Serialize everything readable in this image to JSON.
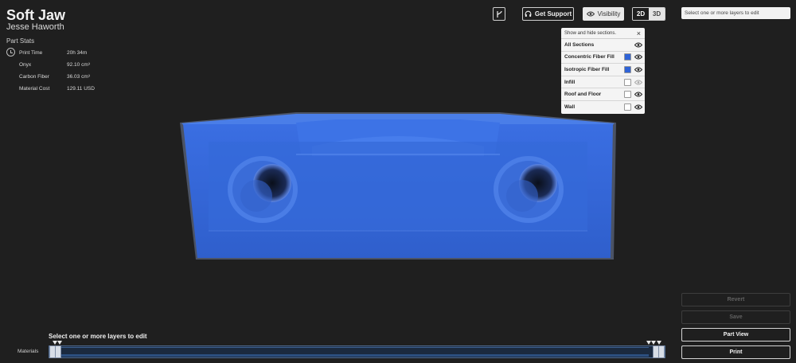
{
  "header": {
    "title": "Soft Jaw",
    "author": "Jesse Haworth"
  },
  "stats": {
    "heading": "Part Stats",
    "rows": [
      {
        "label": "Print Time",
        "value": "20h 34m",
        "icon": "clock-icon"
      },
      {
        "label": "Onyx",
        "value": "92.10 cm³"
      },
      {
        "label": "Carbon Fiber",
        "value": "36.03 cm³"
      },
      {
        "label": "Material Cost",
        "value": "129.11 USD"
      }
    ]
  },
  "toolbar": {
    "branch_icon": "branch-icon",
    "support_label": "Get Support",
    "support_icon": "headset-icon",
    "visibility_label": "Visibility",
    "visibility_icon": "eye-icon",
    "view_2d": "2D",
    "view_3d": "3D",
    "active_view": "3D"
  },
  "layer_select": {
    "placeholder": "Select one or more layers to edit"
  },
  "visibility_panel": {
    "heading": "Show and hide sections.",
    "close_symbol": "×",
    "rows": [
      {
        "label": "All Sections",
        "swatch": null,
        "visible": true
      },
      {
        "label": "Concentric Fiber Fill",
        "swatch": "#2f63d6",
        "visible": true
      },
      {
        "label": "Isotropic Fiber Fill",
        "swatch": "#2f63d6",
        "visible": true
      },
      {
        "label": "Infill",
        "swatch": "#ffffff",
        "visible": false
      },
      {
        "label": "Roof and Floor",
        "swatch": "#ffffff",
        "visible": true
      },
      {
        "label": "Wall",
        "swatch": "#ffffff",
        "visible": true
      }
    ]
  },
  "model": {
    "color": "#3b6fe0"
  },
  "slider": {
    "caption": "Select one or more layers to edit",
    "materials_label": "Materials"
  },
  "actions": {
    "revert": "Revert",
    "save": "Save",
    "part_view": "Part View",
    "print": "Print"
  }
}
